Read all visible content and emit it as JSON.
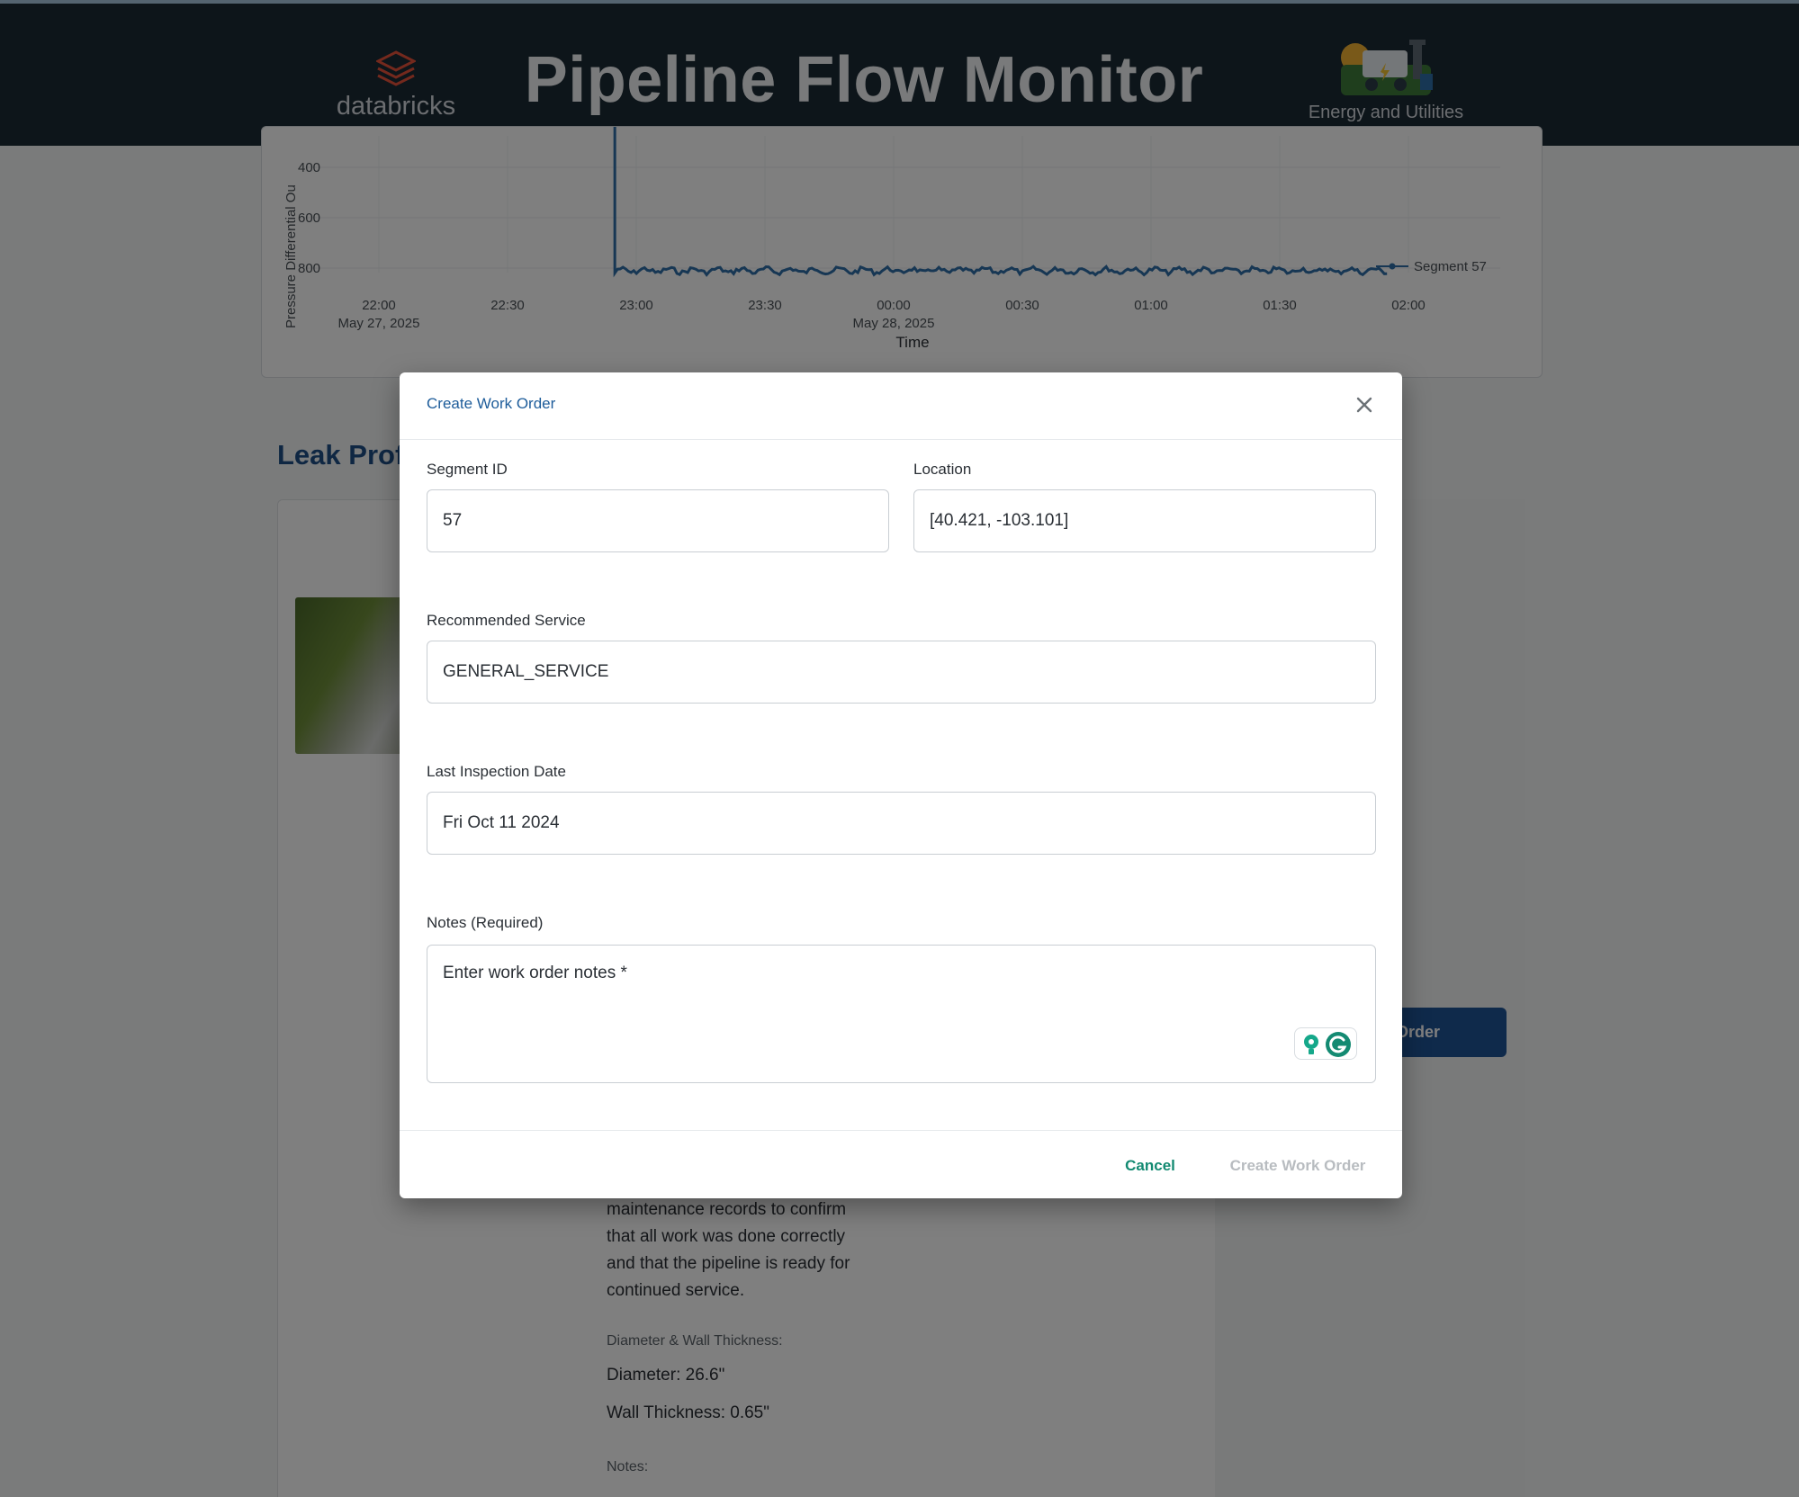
{
  "header": {
    "brand_name": "databricks",
    "title": "Pipeline Flow Monitor",
    "sector_label": "Energy and Utilities"
  },
  "chart_data": {
    "type": "line",
    "ylabel": "Pressure Differential Ou",
    "xlabel": "Time",
    "y_ticks": [
      "400",
      "600",
      "800"
    ],
    "y_reversed": true,
    "ylim": [
      800,
      400
    ],
    "x_ticks": [
      {
        "time": "22:00",
        "date": "May 27, 2025"
      },
      {
        "time": "22:30",
        "date": ""
      },
      {
        "time": "23:00",
        "date": ""
      },
      {
        "time": "23:30",
        "date": ""
      },
      {
        "time": "00:00",
        "date": "May 28, 2025"
      },
      {
        "time": "00:30",
        "date": ""
      },
      {
        "time": "01:00",
        "date": ""
      },
      {
        "time": "01:30",
        "date": ""
      },
      {
        "time": "02:00",
        "date": ""
      }
    ],
    "series": [
      {
        "name": "Segment 57",
        "color": "#2f6fa8",
        "start": "22:55",
        "end": "01:55",
        "approx_value": 810,
        "spike_at_start_to": 300
      }
    ]
  },
  "leak_section": {
    "title": "Leak Prof",
    "report_lines": [
      "maintenance records to confirm",
      "that all work was done correctly",
      "and that the pipeline is ready for",
      "continued service."
    ],
    "spec_label": "Diameter & Wall Thickness:",
    "diameter": "Diameter: 26.6\"",
    "wall_thickness": "Wall Thickness: 0.65\"",
    "notes_label": "Notes:",
    "order_button": "Order"
  },
  "modal": {
    "title": "Create Work Order",
    "segment_label": "Segment ID",
    "segment_value": "57",
    "location_label": "Location",
    "location_value": "[40.421, -103.101]",
    "service_label": "Recommended Service",
    "service_value": "GENERAL_SERVICE",
    "inspection_label": "Last Inspection Date",
    "inspection_value": "Fri Oct 11 2024",
    "notes_label": "Notes (Required)",
    "notes_placeholder": "Enter work order notes *",
    "cancel_label": "Cancel",
    "create_label": "Create Work Order",
    "close_icon": "close-icon",
    "accent": "#1d5c9a",
    "cancel_color": "#138a72"
  }
}
